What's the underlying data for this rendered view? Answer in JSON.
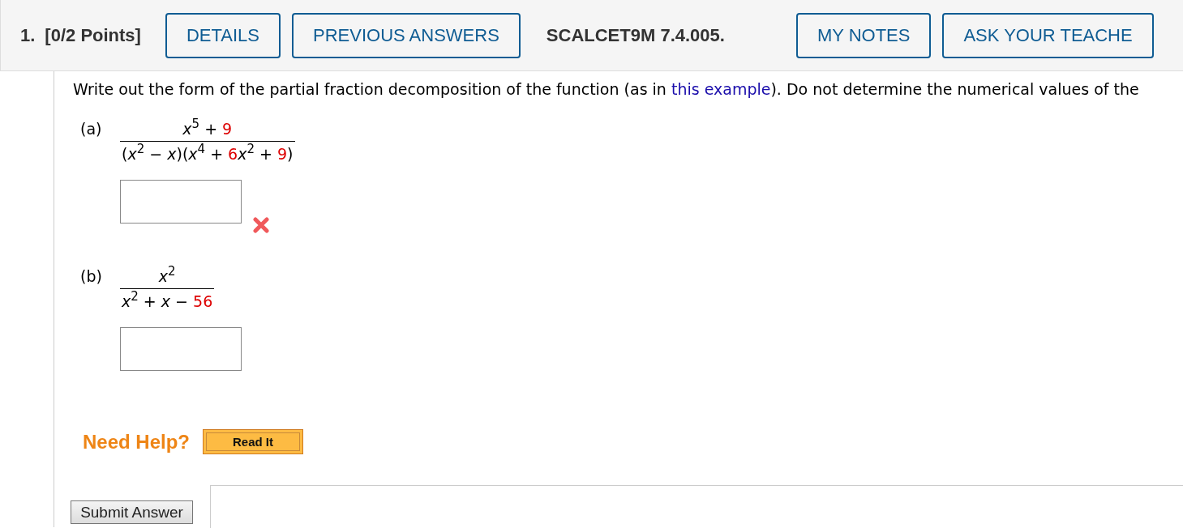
{
  "header": {
    "number": "1.",
    "points": "[0/2 Points]",
    "buttons": [
      {
        "label": "DETAILS",
        "kind": "button"
      },
      {
        "label": "PREVIOUS ANSWERS",
        "kind": "button"
      },
      {
        "label": "SCALCET9M 7.4.005.",
        "kind": "code"
      },
      {
        "label": "MY NOTES",
        "kind": "button"
      },
      {
        "label": "ASK YOUR TEACHE",
        "kind": "button"
      }
    ]
  },
  "instruction": {
    "before": "Write out the form of the partial fraction decomposition of the function (as in ",
    "link": "this example",
    "after": "). Do not determine the numerical values of the"
  },
  "parts": [
    {
      "label": "(a)",
      "incorrect": true,
      "numerator": [
        {
          "text": "x",
          "kind": "var"
        },
        {
          "text": "5",
          "kind": "sup"
        },
        {
          "text": " + ",
          "kind": "op"
        },
        {
          "text": "9",
          "kind": "num"
        }
      ],
      "denominator": [
        {
          "text": "(",
          "kind": "op"
        },
        {
          "text": "x",
          "kind": "var"
        },
        {
          "text": "2",
          "kind": "sup"
        },
        {
          "text": " − ",
          "kind": "op"
        },
        {
          "text": "x",
          "kind": "var"
        },
        {
          "text": ")(",
          "kind": "op"
        },
        {
          "text": "x",
          "kind": "var"
        },
        {
          "text": "4",
          "kind": "sup"
        },
        {
          "text": " + ",
          "kind": "op"
        },
        {
          "text": "6",
          "kind": "num"
        },
        {
          "text": "x",
          "kind": "var"
        },
        {
          "text": "2",
          "kind": "sup"
        },
        {
          "text": " + ",
          "kind": "op"
        },
        {
          "text": "9",
          "kind": "num"
        },
        {
          "text": ")",
          "kind": "op"
        }
      ]
    },
    {
      "label": "(b)",
      "incorrect": false,
      "numerator": [
        {
          "text": "x",
          "kind": "var"
        },
        {
          "text": "2",
          "kind": "sup"
        }
      ],
      "denominator": [
        {
          "text": "x",
          "kind": "var"
        },
        {
          "text": "2",
          "kind": "sup"
        },
        {
          "text": " + ",
          "kind": "op"
        },
        {
          "text": "x",
          "kind": "var"
        },
        {
          "text": " − ",
          "kind": "op"
        },
        {
          "text": "56",
          "kind": "num"
        }
      ]
    }
  ],
  "help": {
    "label": "Need Help?",
    "button": "Read It"
  },
  "submit": "Submit Answer"
}
